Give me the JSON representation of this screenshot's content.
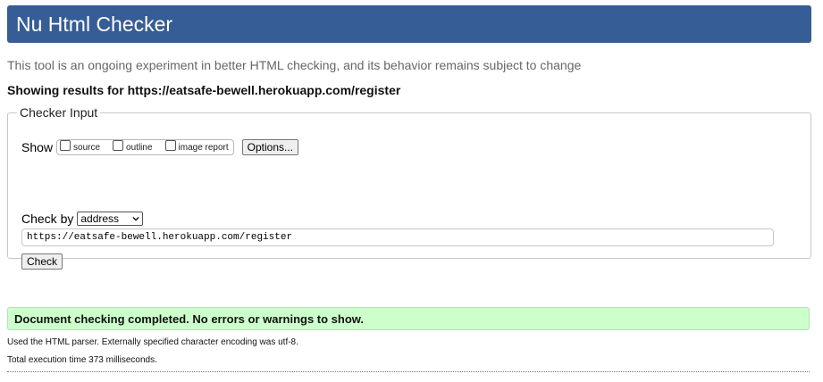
{
  "header": {
    "title": "Nu Html Checker"
  },
  "tagline": "This tool is an ongoing experiment in better HTML checking, and its behavior remains subject to change",
  "showing": "Showing results for https://eatsafe-bewell.herokuapp.com/register",
  "checker": {
    "legend": "Checker Input",
    "show_label": "Show",
    "show_options": [
      {
        "label": "source",
        "checked": false
      },
      {
        "label": "outline",
        "checked": false
      },
      {
        "label": "image report",
        "checked": false
      }
    ],
    "options_button": "Options...",
    "check_by_label": "Check by",
    "check_by_value": "address",
    "url_value": "https://eatsafe-bewell.herokuapp.com/register",
    "check_button": "Check"
  },
  "result": {
    "message": "Document checking completed. No errors or warnings to show.",
    "color": "#ccffcc"
  },
  "footer": {
    "parser_info": "Used the HTML parser. Externally specified character encoding was utf-8.",
    "exec_time": "Total execution time 373 milliseconds."
  },
  "colors": {
    "header_bg": "#365d95"
  }
}
